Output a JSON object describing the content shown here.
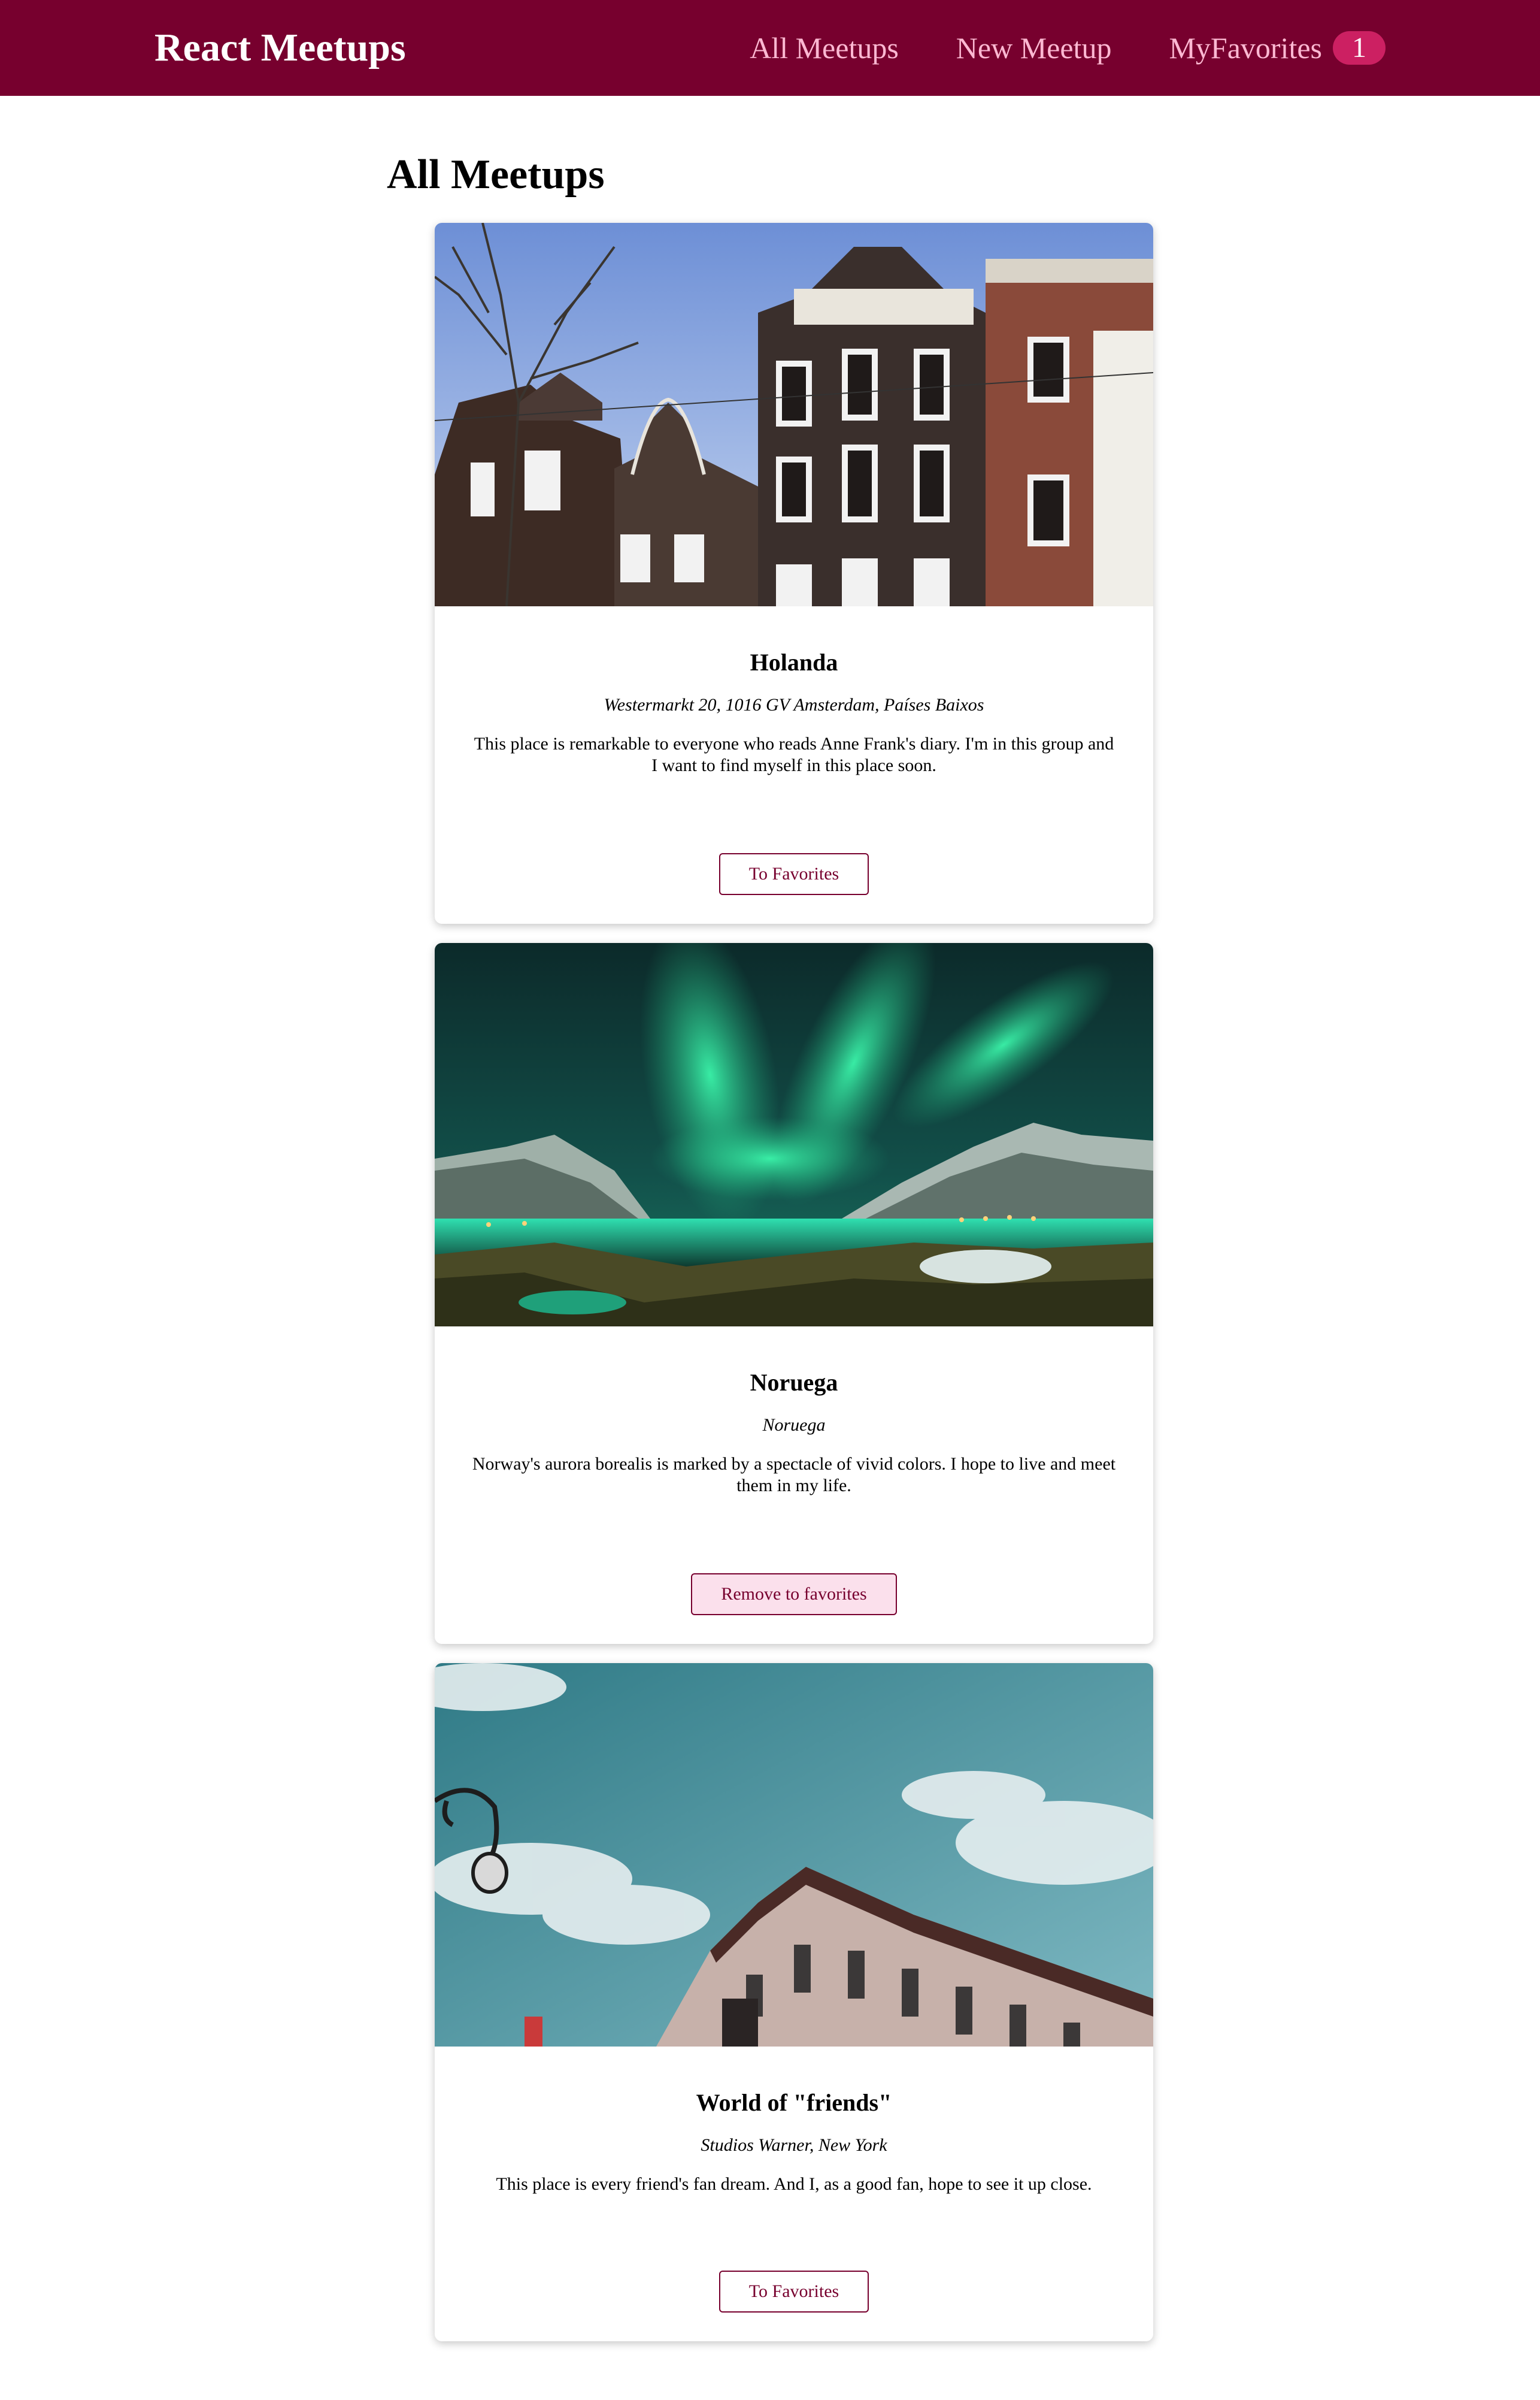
{
  "header": {
    "logo": "React Meetups",
    "nav": {
      "all": "All Meetups",
      "new": "New Meetup",
      "favorites": "MyFavorites",
      "favorites_count": "1"
    },
    "colors": {
      "bar": "#77002e",
      "link": "#fcb8d2",
      "badge": "#cc2062"
    }
  },
  "page": {
    "title": "All Meetups"
  },
  "meetups": [
    {
      "image": "amsterdam-canal-houses-photo",
      "title": "Holanda",
      "address": "Westermarkt 20, 1016 GV Amsterdam, Países Baixos",
      "description": "This place is remarkable to everyone who reads Anne Frank's diary. I'm in this group and I want to find myself in this place soon.",
      "button": "To Favorites",
      "is_favorite": false
    },
    {
      "image": "aurora-borealis-photo",
      "title": "Noruega",
      "address": "Noruega",
      "description": "Norway's aurora borealis is marked by a spectacle of vivid colors. I hope to live and meet them in my life.",
      "button": "Remove to favorites",
      "is_favorite": true
    },
    {
      "image": "new-york-building-sky-photo",
      "title": "World of \"friends\"",
      "address": "Studios Warner, New York",
      "description": "This place is every friend's fan dream. And I, as a good fan, hope to see it up close.",
      "button": "To Favorites",
      "is_favorite": false
    }
  ]
}
